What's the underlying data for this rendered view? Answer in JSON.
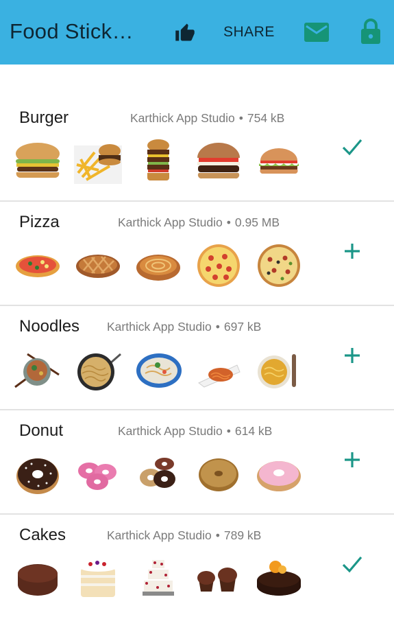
{
  "app_bar": {
    "title": "Food Stick…",
    "share_label": "SHARE",
    "like_icon": "thumbs-up-icon",
    "mail_icon": "mail-icon",
    "lock_icon": "lock-icon",
    "color": "#3ab1e1"
  },
  "packs": [
    {
      "name": "Burger",
      "publisher": "Karthick App Studio",
      "size": "754 kB",
      "status": "added",
      "stickers": [
        "burger-sticker",
        "burger-fries-sticker",
        "stacked-burger-sticker",
        "bacon-burger-sticker",
        "salad-burger-sticker"
      ]
    },
    {
      "name": "Pizza",
      "publisher": "Karthick App Studio",
      "size": "0.95 MB",
      "status": "add",
      "stickers": [
        "veggie-pizza-sticker",
        "lattice-pie-sticker",
        "cheese-pizza-sticker",
        "pepperoni-pizza-sticker",
        "supreme-pizza-sticker"
      ]
    },
    {
      "name": "Noodles",
      "publisher": "Karthick App Studio",
      "size": "697 kB",
      "status": "add",
      "stickers": [
        "noodle-bowl-chopsticks-sticker",
        "fried-noodles-pan-sticker",
        "noodle-plate-sticker",
        "noodle-dish-sticker",
        "noodle-soup-sticker"
      ]
    },
    {
      "name": "Donut",
      "publisher": "Karthick App Studio",
      "size": "614 kB",
      "status": "add",
      "stickers": [
        "chocolate-sprinkle-donut-sticker",
        "pink-mini-donuts-sticker",
        "donut-stack-sticker",
        "glazed-donut-sticker",
        "pink-glazed-donut-sticker"
      ]
    },
    {
      "name": "Cakes",
      "publisher": "Karthick App Studio",
      "size": "789 kB",
      "status": "added",
      "stickers": [
        "chocolate-lava-cake-sticker",
        "layer-cake-sticker",
        "tiered-cake-sticker",
        "cupcakes-sticker",
        "chocolate-tart-sticker"
      ]
    }
  ],
  "separator": "•"
}
